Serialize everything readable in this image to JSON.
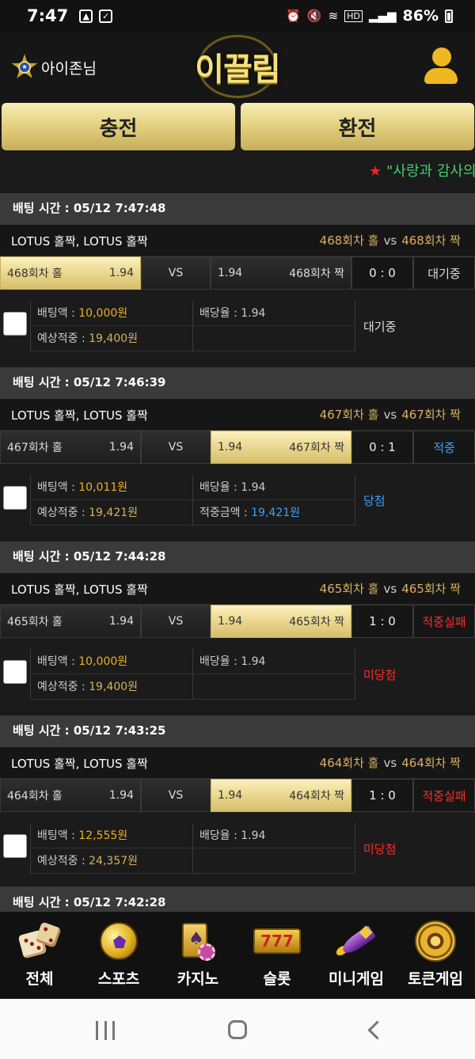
{
  "status_bar": {
    "time": "7:47",
    "battery": "86%",
    "hd_label": "HD"
  },
  "header": {
    "user_name": "아이존님",
    "logo": "이끌림"
  },
  "actions": {
    "charge": "충전",
    "exchange": "환전"
  },
  "ticker": {
    "star": "★",
    "text": "\"사랑과 감사의"
  },
  "bets": [
    {
      "time": "배팅 시간 : 05/12 7:47:48",
      "game": "LOTUS 홀짝, LOTUS 홀짝",
      "home_label": "468회차 홀",
      "vs": "vs",
      "away_label": "468회차 짝",
      "home": "468회차 홀",
      "home_odds": "1.94",
      "vs_btn": "VS",
      "away_odds": "1.94",
      "away": "468회차 짝",
      "score": "0 : 0",
      "result": "대기중",
      "amount_label": "배팅액 : ",
      "amount": "10,000원",
      "odds_label": "배당율 : ",
      "odds": "1.94",
      "expected_label": "예상적중 : ",
      "expected": "19,400원",
      "win_label": "",
      "win": "",
      "status": "대기중"
    },
    {
      "time": "배팅 시간 : 05/12 7:46:39",
      "game": "LOTUS 홀짝, LOTUS 홀짝",
      "home_label": "467회차 홀",
      "vs": "vs",
      "away_label": "467회차 짝",
      "home": "467회차 홀",
      "home_odds": "1.94",
      "vs_btn": "VS",
      "away_odds": "1.94",
      "away": "467회차 짝",
      "score": "0 : 1",
      "result": "적중",
      "amount_label": "배팅액 : ",
      "amount": "10,011원",
      "odds_label": "배당율 : ",
      "odds": "1.94",
      "expected_label": "예상적중 : ",
      "expected": "19,421원",
      "win_label": "적중금액 : ",
      "win": "19,421원",
      "status": "당첨"
    },
    {
      "time": "배팅 시간 : 05/12 7:44:28",
      "game": "LOTUS 홀짝, LOTUS 홀짝",
      "home_label": "465회차 홀",
      "vs": "vs",
      "away_label": "465회차 짝",
      "home": "465회차 홀",
      "home_odds": "1.94",
      "vs_btn": "VS",
      "away_odds": "1.94",
      "away": "465회차 짝",
      "score": "1 : 0",
      "result": "적중실패",
      "amount_label": "배팅액 : ",
      "amount": "10,000원",
      "odds_label": "배당율 : ",
      "odds": "1.94",
      "expected_label": "예상적중 : ",
      "expected": "19,400원",
      "win_label": "",
      "win": "",
      "status": "미당첨"
    },
    {
      "time": "배팅 시간 : 05/12 7:43:25",
      "game": "LOTUS 홀짝, LOTUS 홀짝",
      "home_label": "464회차 홀",
      "vs": "vs",
      "away_label": "464회차 짝",
      "home": "464회차 홀",
      "home_odds": "1.94",
      "vs_btn": "VS",
      "away_odds": "1.94",
      "away": "464회차 짝",
      "score": "1 : 0",
      "result": "적중실패",
      "amount_label": "배팅액 : ",
      "amount": "12,555원",
      "odds_label": "배당율 : ",
      "odds": "1.94",
      "expected_label": "예상적중 : ",
      "expected": "24,357원",
      "win_label": "",
      "win": "",
      "status": "미당첨"
    }
  ],
  "next_bet_time": "배팅 시간 : 05/12 7:42:28",
  "tabs": [
    {
      "label": "전체",
      "icon": "dice-icon"
    },
    {
      "label": "스포츠",
      "icon": "soccer-ball-icon"
    },
    {
      "label": "카지노",
      "icon": "casino-cards-icon"
    },
    {
      "label": "슬롯",
      "icon": "slot-777-icon",
      "glyphs": "777"
    },
    {
      "label": "미니게임",
      "icon": "rocket-icon"
    },
    {
      "label": "토큰게임",
      "icon": "roulette-icon"
    }
  ],
  "colors": {
    "gold": "#e2cf7e",
    "win_blue": "#3aa0ff",
    "lose_red": "#ff2a2a",
    "amount_gold": "#f0b020"
  }
}
